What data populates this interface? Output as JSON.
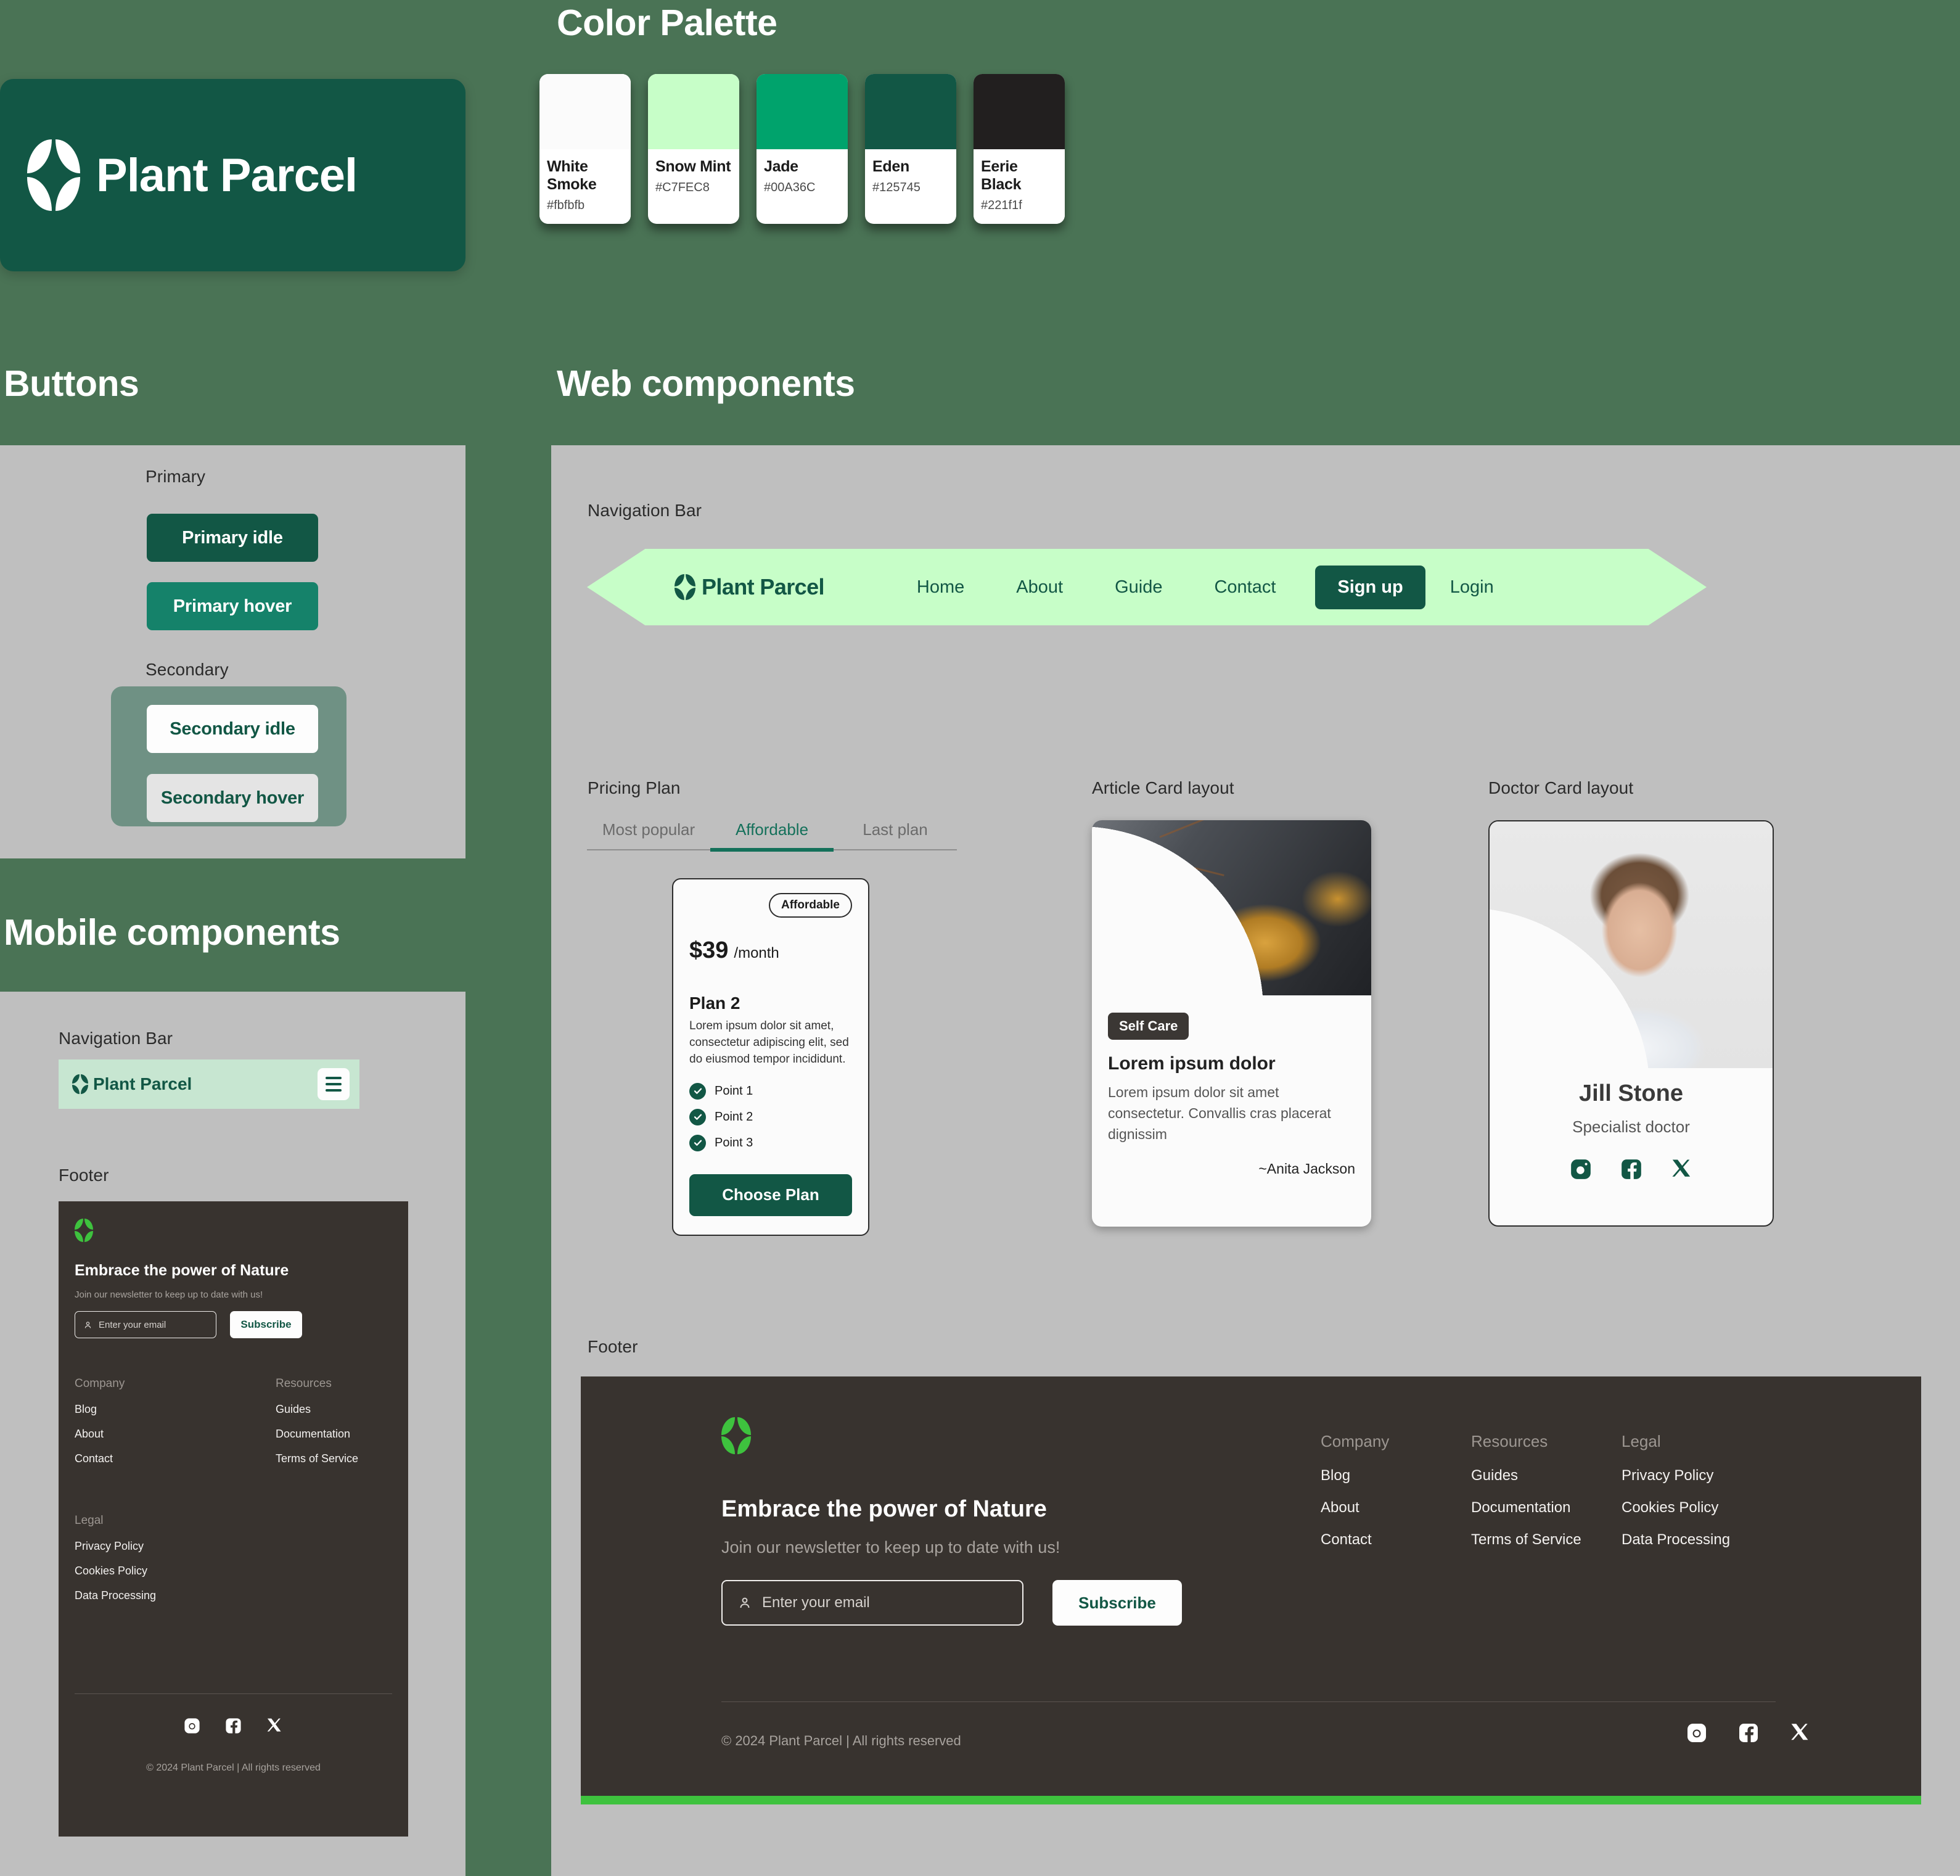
{
  "headings": {
    "palette": "Color Palette",
    "buttons": "Buttons",
    "web": "Web components",
    "mobile": "Mobile components"
  },
  "brand": {
    "name": "Plant Parcel",
    "logo_icon": "four-petal-flower-icon"
  },
  "palette": {
    "swatches": [
      {
        "name": "White Smoke",
        "hex": "#fbfbfb"
      },
      {
        "name": "Snow Mint",
        "hex": "#C7FEC8"
      },
      {
        "name": "Jade",
        "hex": "#00A36C"
      },
      {
        "name": "Eden",
        "hex": "#125745"
      },
      {
        "name": "Eerie Black",
        "hex": "#221f1f"
      }
    ]
  },
  "buttons": {
    "primary_label": "Primary",
    "secondary_label": "Secondary",
    "primary_idle": "Primary idle",
    "primary_hover": "Primary hover",
    "secondary_idle": "Secondary idle",
    "secondary_hover": "Secondary hover"
  },
  "web": {
    "nav_label": "Navigation Bar",
    "pricing_label": "Pricing Plan",
    "article_label": "Article Card layout",
    "doctor_label": "Doctor Card layout",
    "footer_label": "Footer",
    "nav": {
      "links": [
        "Home",
        "About",
        "Guide",
        "Contact"
      ],
      "signup": "Sign up",
      "login": "Login"
    },
    "pricing": {
      "tabs": [
        "Most popular",
        "Affordable",
        "Last plan"
      ],
      "active_tab": "Affordable",
      "badge": "Affordable",
      "price": "$39",
      "period": "/month",
      "plan_name": "Plan 2",
      "plan_desc": "Lorem ipsum dolor sit amet, consectetur adipiscing elit, sed do eiusmod tempor incididunt.",
      "points": [
        "Point 1",
        "Point 2",
        "Point 3"
      ],
      "cta": "Choose Plan"
    },
    "article": {
      "tag": "Self Care",
      "title": "Lorem ipsum dolor",
      "body": "Lorem ipsum dolor sit amet consectetur. Convallis cras placerat dignissim",
      "author": "~Anita Jackson"
    },
    "doctor": {
      "name": "Jill Stone",
      "role": "Specialist doctor",
      "socials": [
        "instagram-icon",
        "facebook-icon",
        "x-twitter-icon"
      ]
    }
  },
  "footer": {
    "title": "Embrace the power of Nature",
    "subtitle": "Join our newsletter to keep up to date with us!",
    "email_placeholder": "Enter your email",
    "subscribe": "Subscribe",
    "copyright": "© 2024 Plant Parcel | All rights reserved",
    "accent_color": "#3ec23e",
    "columns": [
      {
        "title": "Company",
        "links": [
          "Blog",
          "About",
          "Contact"
        ]
      },
      {
        "title": "Resources",
        "links": [
          "Guides",
          "Documentation",
          "Terms of Service"
        ]
      },
      {
        "title": "Legal",
        "links": [
          "Privacy Policy",
          "Cookies Policy",
          "Data Processing"
        ]
      }
    ],
    "socials": [
      "instagram-icon",
      "facebook-icon",
      "x-twitter-icon"
    ]
  },
  "mobile": {
    "nav_label": "Navigation Bar",
    "footer_label": "Footer"
  }
}
